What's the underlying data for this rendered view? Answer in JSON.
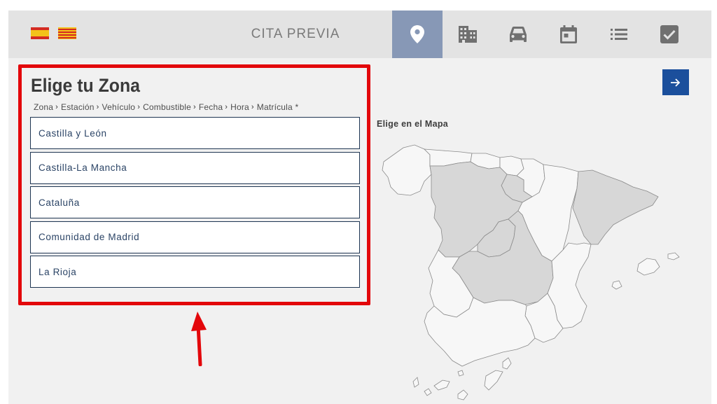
{
  "header": {
    "brand": "CITA PREVIA",
    "languages": [
      "es-flag-icon",
      "catalan-flag-icon"
    ],
    "steps": [
      {
        "icon": "location-pin-icon",
        "active": true
      },
      {
        "icon": "building-icon",
        "active": false
      },
      {
        "icon": "car-icon",
        "active": false
      },
      {
        "icon": "calendar-icon",
        "active": false
      },
      {
        "icon": "list-icon",
        "active": false
      },
      {
        "icon": "checkbox-icon",
        "active": false
      }
    ],
    "active_color": "#8798b6"
  },
  "panel": {
    "title": "Elige tu Zona",
    "breadcrumb": [
      "Zona",
      "Estación",
      "Vehículo",
      "Combustible",
      "Fecha",
      "Hora",
      "Matrícula *"
    ],
    "zones": [
      "Castilla y León",
      "Castilla-La Mancha",
      "Cataluña",
      "Comunidad de Madrid",
      "La Rioja"
    ],
    "highlight_color": "#e3070b"
  },
  "map": {
    "label": "Elige en el Mapa",
    "highlighted_regions": [
      "Castilla y León",
      "Castilla-La Mancha",
      "Cataluña",
      "Comunidad de Madrid",
      "La Rioja"
    ],
    "highlight_fill": "#d7d7d7"
  },
  "next_button_icon": "arrow-right-icon",
  "accent": "#1b4f9c"
}
